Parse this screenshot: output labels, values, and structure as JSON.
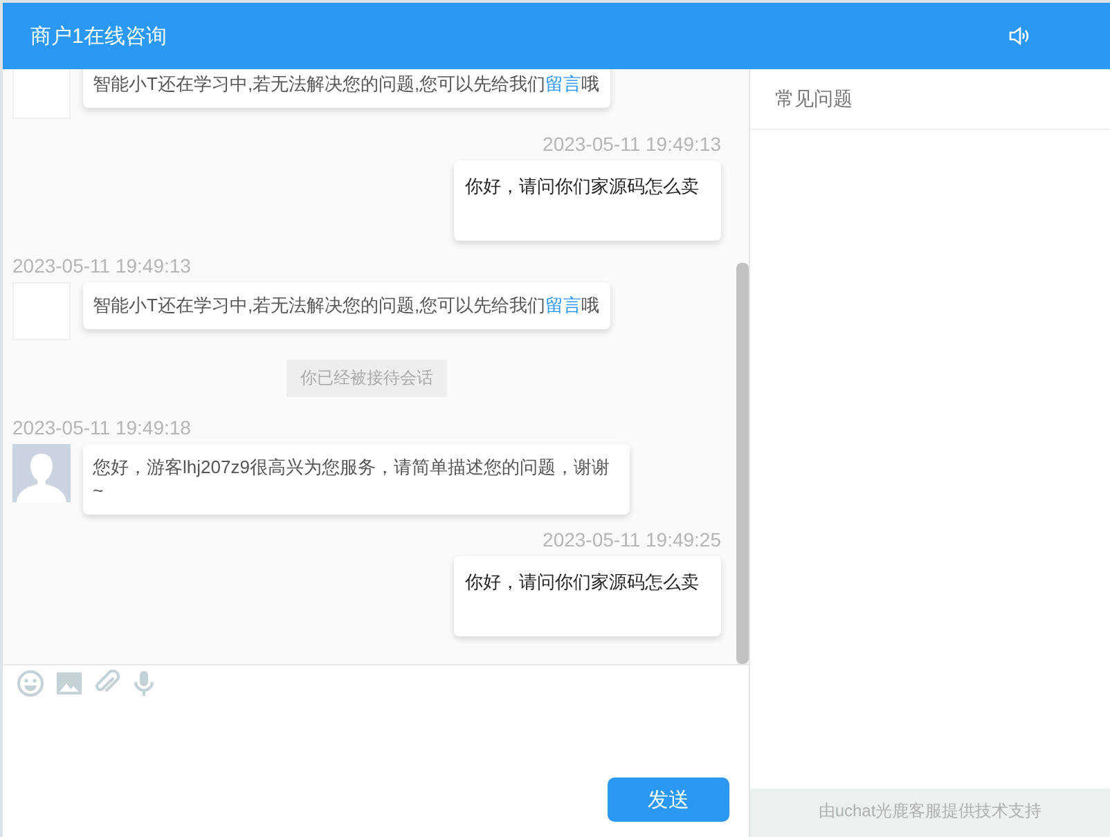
{
  "header": {
    "title": "商户1在线咨询"
  },
  "messages": [
    {
      "kind": "bot",
      "text_before": "智能小T还在学习中,若无法解决您的问题,您可以先给我们",
      "link": "留言",
      "text_after": "哦"
    },
    {
      "kind": "user",
      "time": "2023-05-11 19:49:13",
      "text": "你好，请问你们家源码怎么卖"
    },
    {
      "kind": "bot",
      "time": "2023-05-11 19:49:13",
      "text_before": "智能小T还在学习中,若无法解决您的问题,您可以先给我们",
      "link": "留言",
      "text_after": "哦"
    },
    {
      "kind": "system",
      "text": "你已经被接待会话"
    },
    {
      "kind": "agent",
      "time": "2023-05-11 19:49:18",
      "text": "您好，游客lhj207z9很高兴为您服务，请简单描述您的问题，谢谢~"
    },
    {
      "kind": "user",
      "time": "2023-05-11 19:49:25",
      "text": "你好，请问你们家源码怎么卖"
    }
  ],
  "composer": {
    "send": "发送"
  },
  "side_panel": {
    "title": "常见问题",
    "footer": "由uchat光鹿客服提供技术支持"
  }
}
